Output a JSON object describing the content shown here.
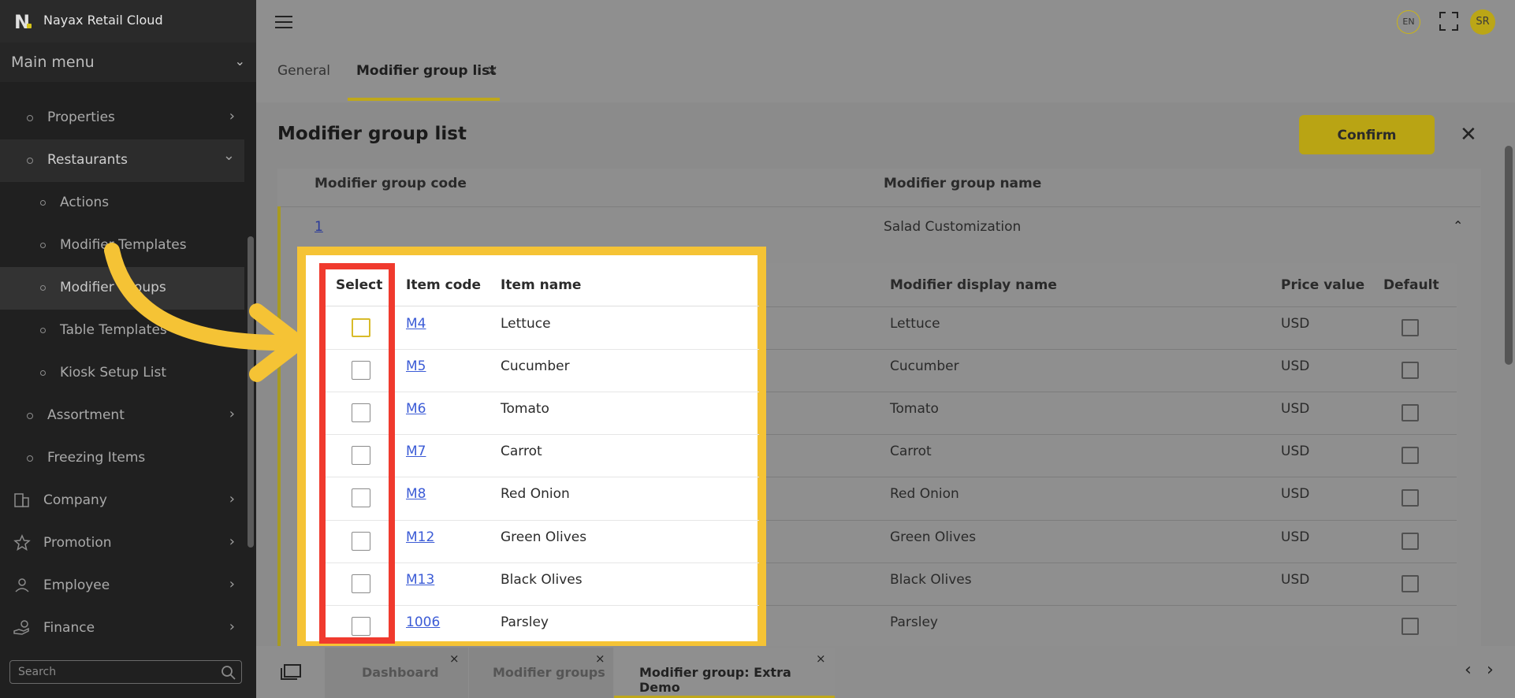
{
  "app": {
    "name": "Nayax Retail Cloud"
  },
  "sidebar": {
    "menu_title": "Main menu",
    "items": [
      {
        "label": "Properties"
      },
      {
        "label": "Restaurants"
      },
      {
        "label": "Actions"
      },
      {
        "label": "Modifier Templates"
      },
      {
        "label": "Modifier Groups"
      },
      {
        "label": "Table Templates"
      },
      {
        "label": "Kiosk Setup List"
      },
      {
        "label": "Assortment"
      },
      {
        "label": "Freezing Items"
      },
      {
        "label": "Company"
      },
      {
        "label": "Promotion"
      },
      {
        "label": "Employee"
      },
      {
        "label": "Finance"
      }
    ],
    "search_placeholder": "Search"
  },
  "header": {
    "language": "EN",
    "user_initials": "SR",
    "tabs": [
      {
        "label": "General"
      },
      {
        "label": "Modifier group list"
      }
    ]
  },
  "page": {
    "title": "Modifier group list",
    "confirm_label": "Confirm",
    "columns": {
      "code": "Modifier group code",
      "name": "Modifier group name"
    },
    "group": {
      "code": "1",
      "name": "Salad Customization"
    }
  },
  "items_table": {
    "headers": {
      "select": "Select",
      "item_code": "Item code",
      "item_name": "Item name",
      "display_name": "Modifier display name",
      "price": "Price value",
      "default": "Default"
    },
    "rows": [
      {
        "code": "M4",
        "name": "Lettuce",
        "display": "Lettuce",
        "price": "USD"
      },
      {
        "code": "M5",
        "name": "Cucumber",
        "display": "Cucumber",
        "price": "USD"
      },
      {
        "code": "M6",
        "name": "Tomato",
        "display": "Tomato",
        "price": "USD"
      },
      {
        "code": "M7",
        "name": "Carrot",
        "display": "Carrot",
        "price": "USD"
      },
      {
        "code": "M8",
        "name": "Red Onion",
        "display": "Red Onion",
        "price": "USD"
      },
      {
        "code": "M12",
        "name": "Green Olives",
        "display": "Green Olives",
        "price": "USD"
      },
      {
        "code": "M13",
        "name": "Black Olives",
        "display": "Black Olives",
        "price": "USD"
      },
      {
        "code": "1006",
        "name": "Parsley",
        "display": "Parsley",
        "price": ""
      }
    ]
  },
  "bottom_tabs": [
    {
      "label": "Dashboard"
    },
    {
      "label": "Modifier groups"
    },
    {
      "label": "Modifier group: Extra Demo"
    }
  ],
  "colors": {
    "accent": "#f5c335",
    "select_frame": "#f03a2e",
    "confirm": "#b9a414"
  }
}
